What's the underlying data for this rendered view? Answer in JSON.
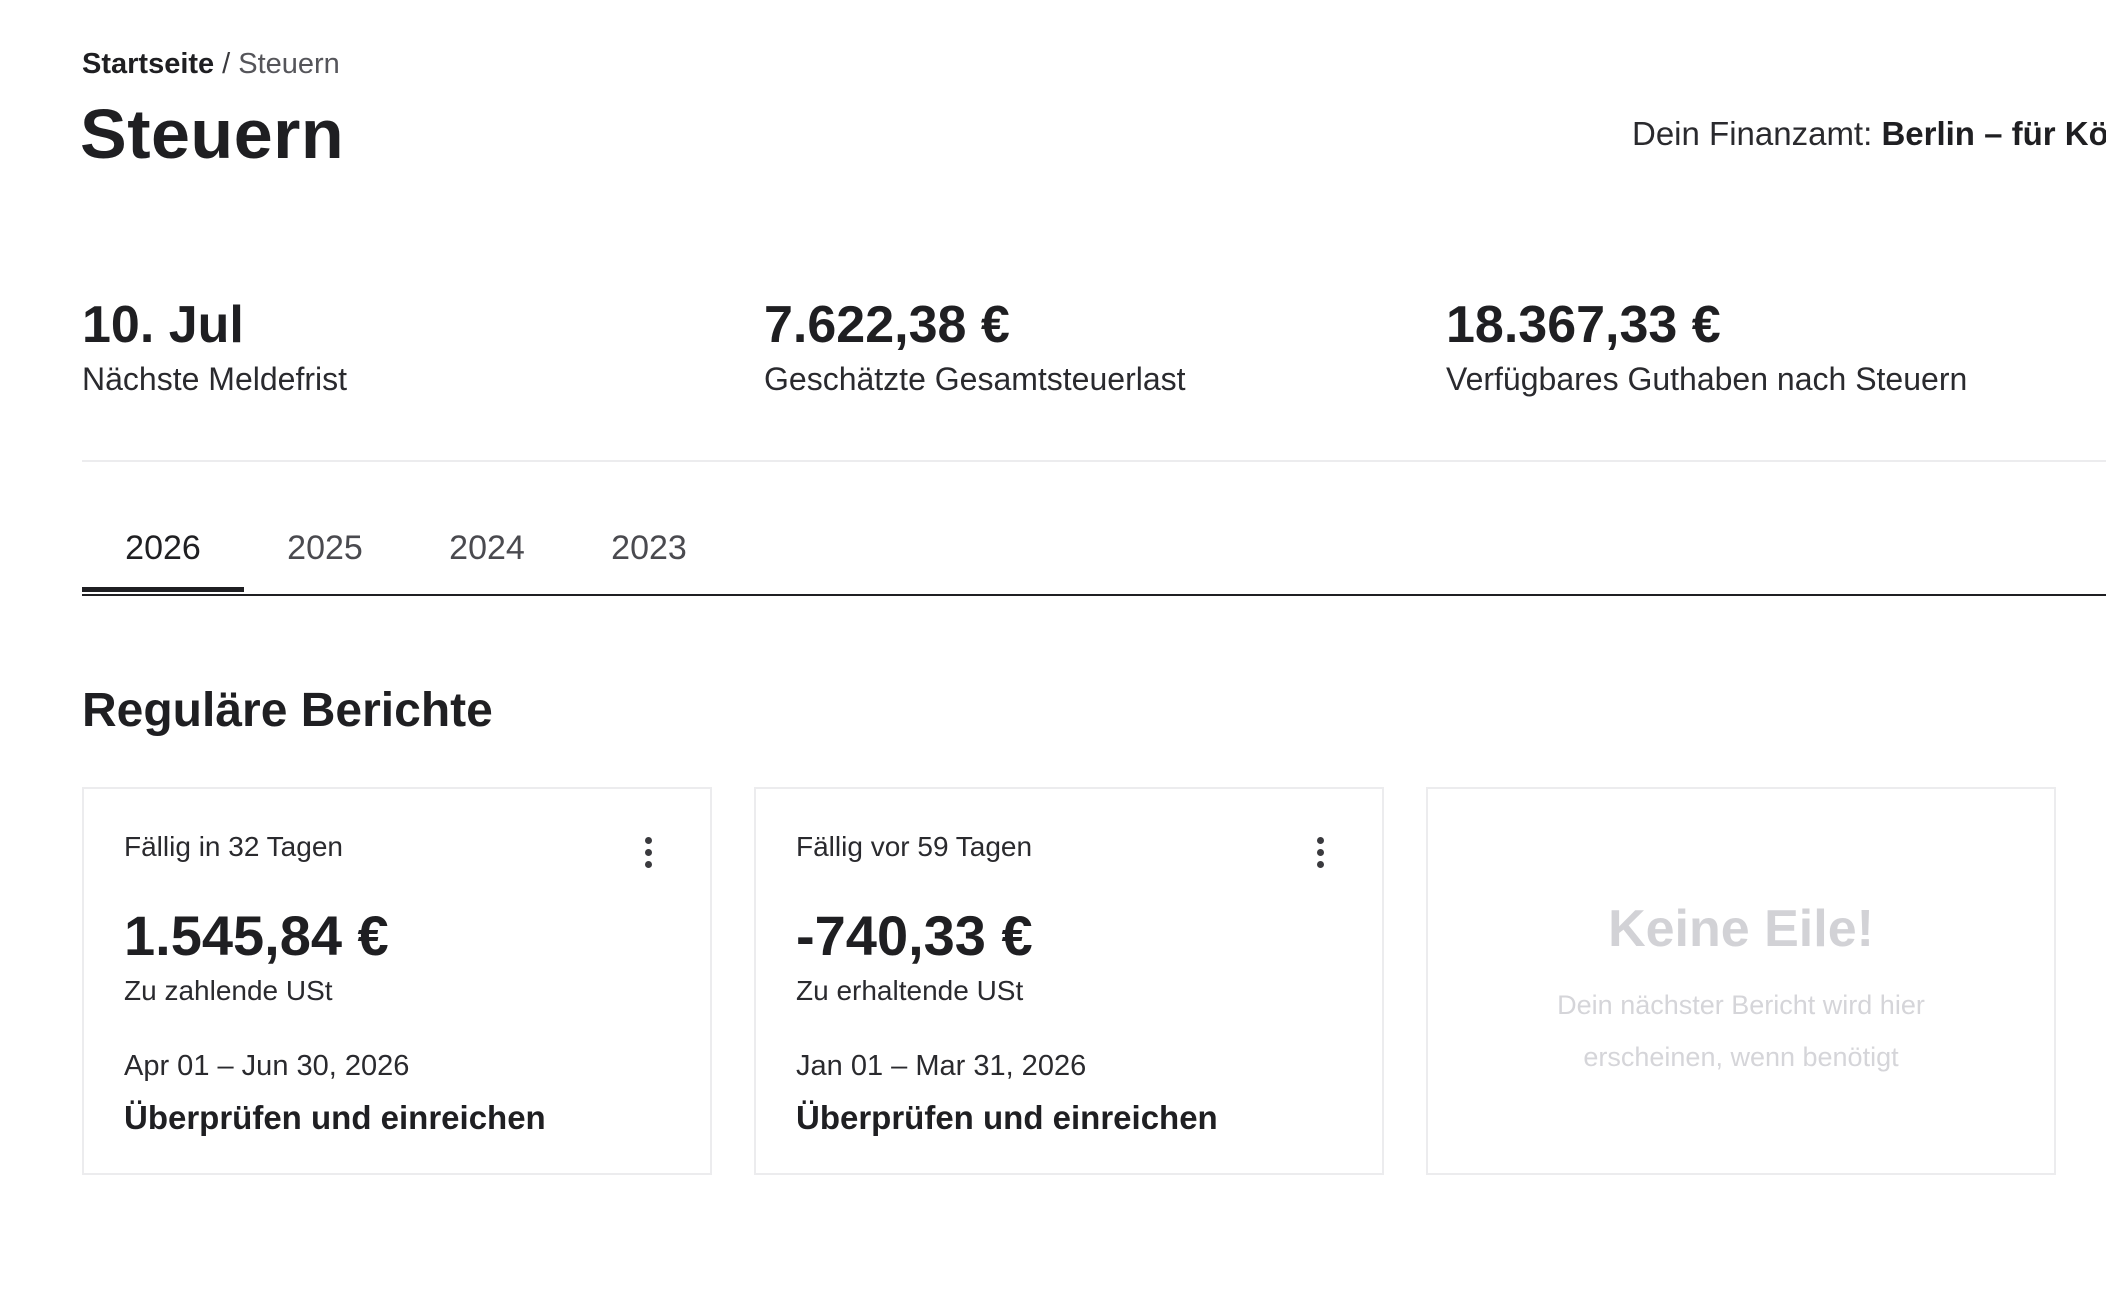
{
  "breadcrumb": {
    "home": "Startseite",
    "separator": "/",
    "current": "Steuern"
  },
  "header": {
    "title": "Steuern",
    "tax_office_label": "Dein Finanzamt:",
    "tax_office_name": "Berlin – für Körp"
  },
  "stats": [
    {
      "value": "10. Jul",
      "label": "Nächste Meldefrist"
    },
    {
      "value": "7.622,38 €",
      "label": "Geschätzte Gesamtsteuerlast"
    },
    {
      "value": "18.367,33 €",
      "label": "Verfügbares Guthaben nach Steuern"
    }
  ],
  "tabs": [
    {
      "label": "2026",
      "active": true
    },
    {
      "label": "2025",
      "active": false
    },
    {
      "label": "2024",
      "active": false
    },
    {
      "label": "2023",
      "active": false
    }
  ],
  "section": {
    "title": "Reguläre Berichte"
  },
  "reports": [
    {
      "due": "Fällig in 32 Tagen",
      "amount": "1.545,84 €",
      "type": "Zu zahlende USt",
      "period": "Apr 01 – Jun 30, 2026",
      "action": "Überprüfen und einreichen",
      "menu_icon": "more-vertical-icon"
    },
    {
      "due": "Fällig vor 59 Tagen",
      "amount": "-740,33 €",
      "type": "Zu erhaltende USt",
      "period": "Jan 01 – Mar 31, 2026",
      "action": "Überprüfen und einreichen",
      "menu_icon": "more-vertical-icon"
    }
  ],
  "empty_card": {
    "title": "Keine Eile!",
    "text": "Dein nächster Bericht wird hier erscheinen, wenn benötigt"
  },
  "colors": {
    "text": "#1f1f22",
    "border": "#ececee",
    "muted": "#d2d2d6"
  }
}
